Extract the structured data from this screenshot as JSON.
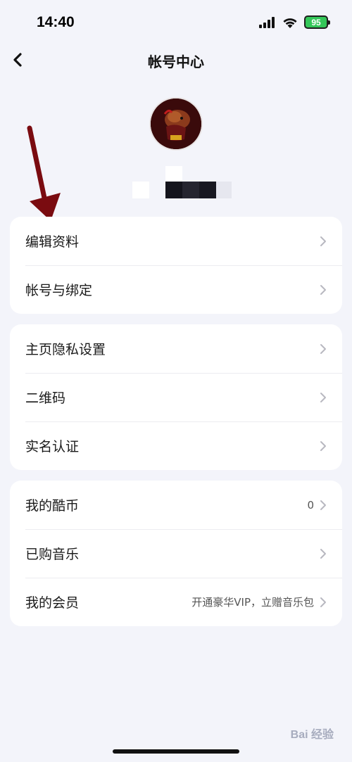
{
  "status_bar": {
    "time": "14:40",
    "battery": "95",
    "icons": [
      "signal-icon",
      "wifi-icon",
      "battery-icon"
    ]
  },
  "nav": {
    "title": "帐号中心",
    "back_icon": "chevron-left-icon"
  },
  "profile": {
    "avatar": "avatar-image",
    "name": ""
  },
  "sections": [
    {
      "items": [
        {
          "label": "编辑资料",
          "value": ""
        },
        {
          "label": "帐号与绑定",
          "value": ""
        }
      ]
    },
    {
      "items": [
        {
          "label": "主页隐私设置",
          "value": ""
        },
        {
          "label": "二维码",
          "value": ""
        },
        {
          "label": "实名认证",
          "value": ""
        }
      ]
    },
    {
      "items": [
        {
          "label": "我的酷币",
          "value": "0"
        },
        {
          "label": "已购音乐",
          "value": ""
        },
        {
          "label": "我的会员",
          "value": "开通豪华VIP，立赠音乐包"
        }
      ]
    }
  ],
  "watermark": "Bai 经验",
  "colors": {
    "background": "#f3f4fa",
    "card": "#ffffff",
    "battery": "#34c759",
    "arrow": "#7a0b10"
  }
}
